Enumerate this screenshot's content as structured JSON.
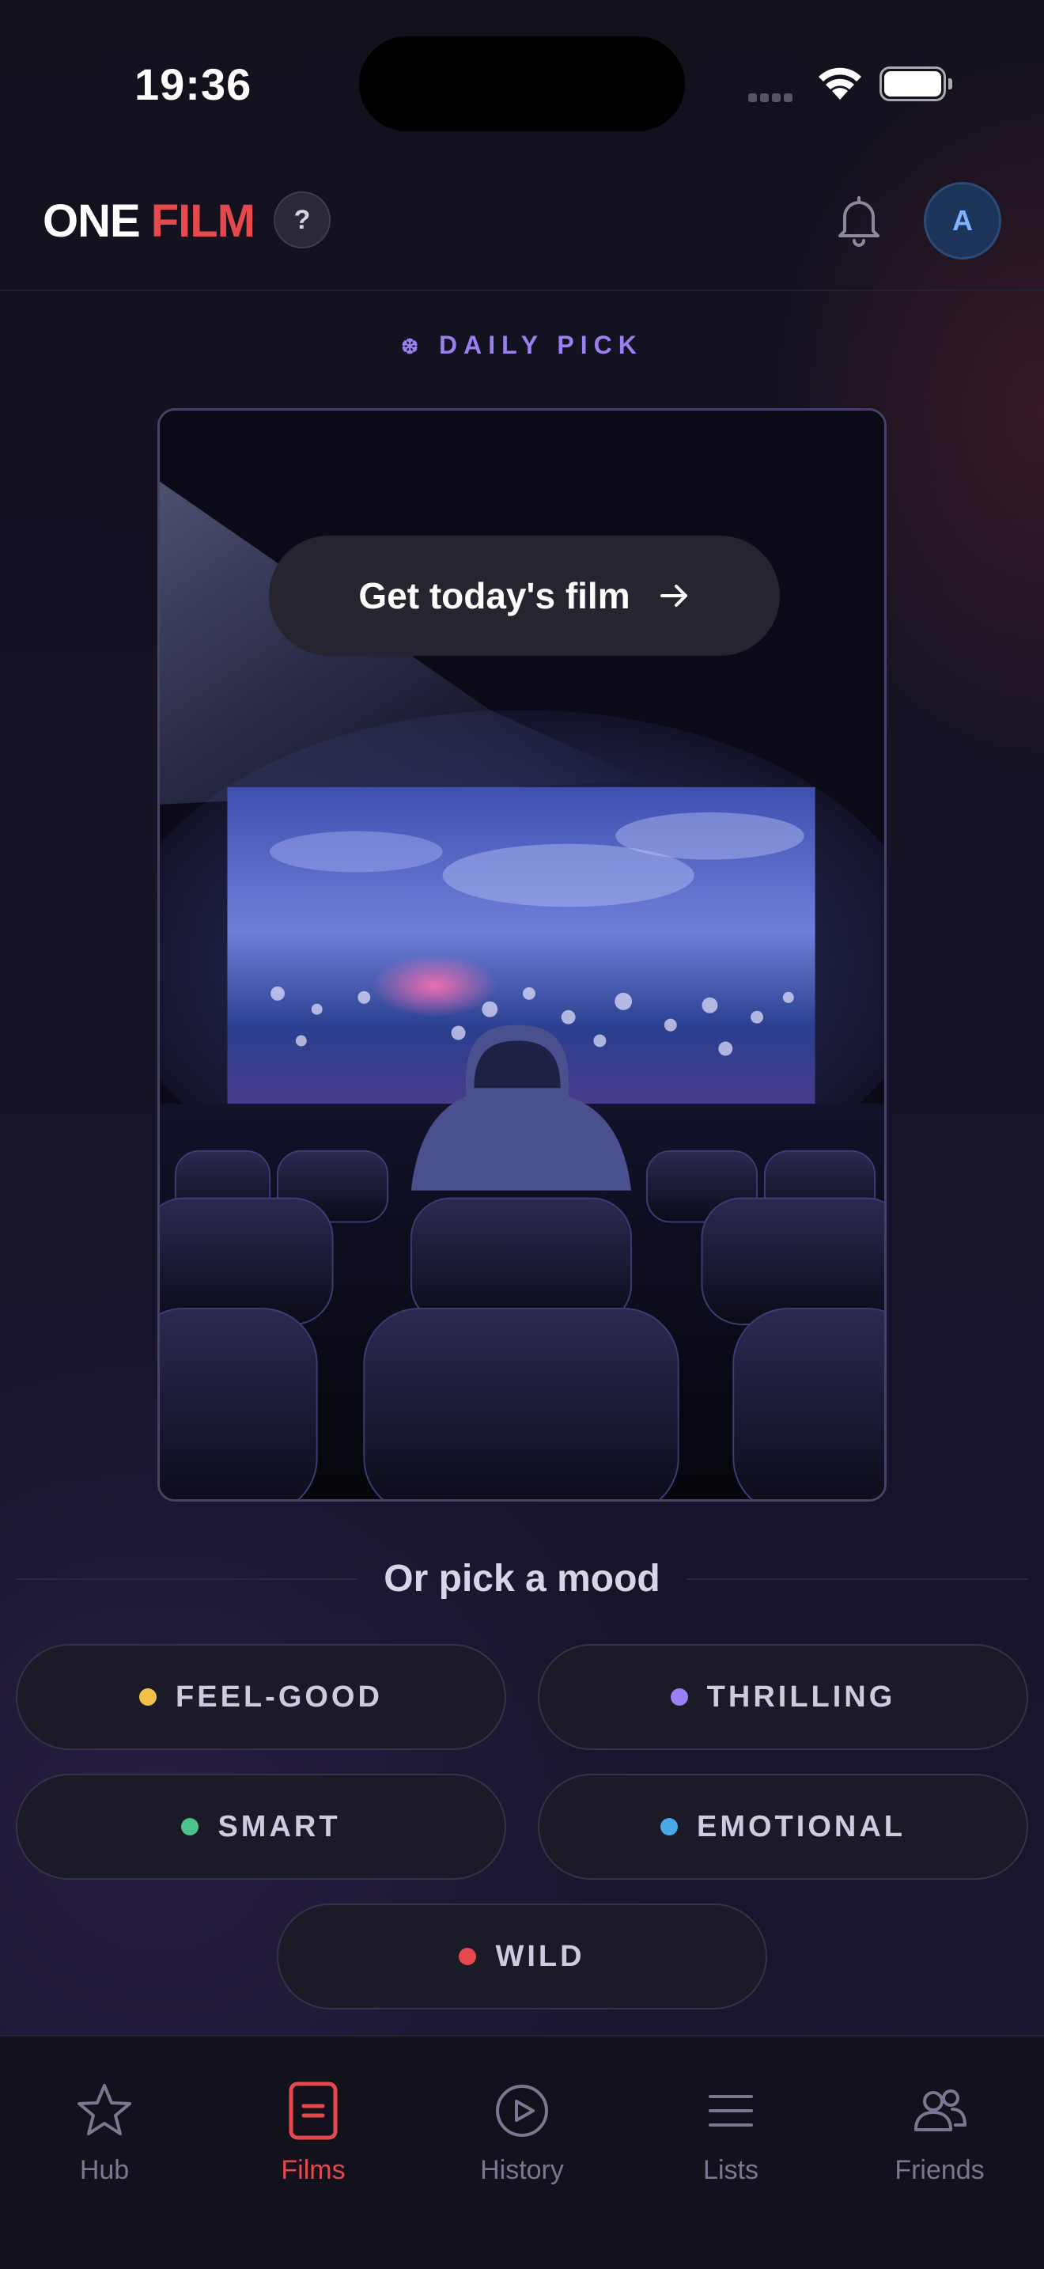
{
  "status_bar": {
    "time": "19:36"
  },
  "header": {
    "logo_part1": "ONE",
    "logo_part2": "FILM",
    "help_label": "?",
    "avatar_initial": "A",
    "accent_color": "#e5484d"
  },
  "daily": {
    "label": "DAILY PICK",
    "icon": "sparkle-icon",
    "cta_label": "Get today's film",
    "cta_icon": "arrow-right-icon"
  },
  "mood": {
    "title": "Or pick a mood",
    "options": [
      {
        "label": "FEEL-GOOD",
        "color": "#f5c04a"
      },
      {
        "label": "THRILLING",
        "color": "#9d7ff5"
      },
      {
        "label": "SMART",
        "color": "#4cc38a"
      },
      {
        "label": "EMOTIONAL",
        "color": "#4aa8e8"
      },
      {
        "label": "WILD",
        "color": "#e5484d"
      }
    ]
  },
  "tabs": [
    {
      "label": "Hub",
      "icon": "star-icon"
    },
    {
      "label": "Films",
      "icon": "film-card-icon",
      "active": true
    },
    {
      "label": "History",
      "icon": "play-circle-icon"
    },
    {
      "label": "Lists",
      "icon": "list-icon"
    },
    {
      "label": "Friends",
      "icon": "friends-icon"
    }
  ]
}
